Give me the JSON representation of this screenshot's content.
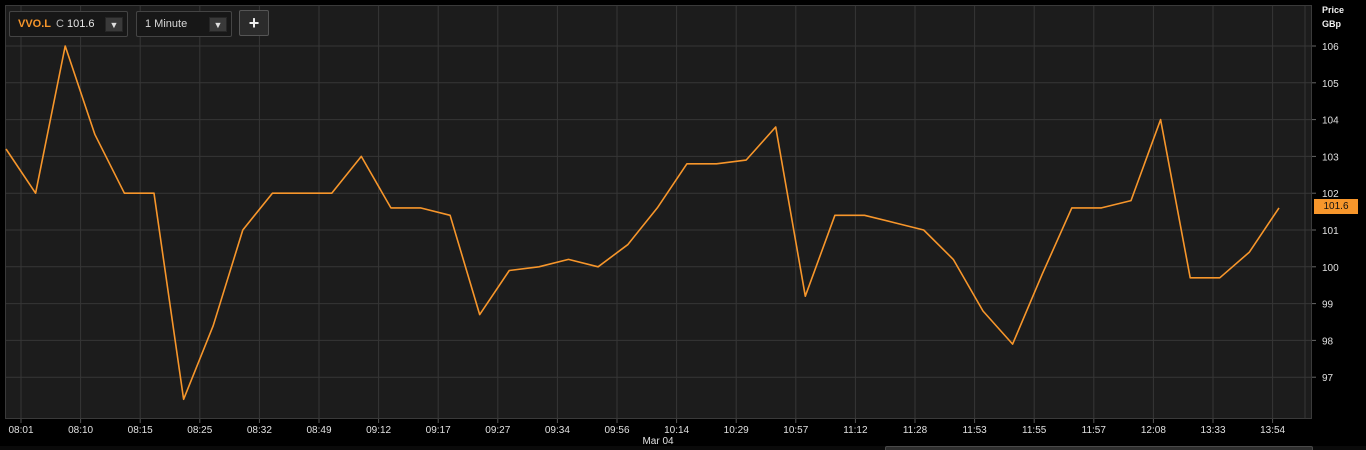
{
  "toolbar": {
    "symbol": "VVO.L",
    "close_label": "C",
    "close_value": "101.6",
    "interval": "1 Minute",
    "dropdown_glyph": "▼",
    "add_glyph": "+",
    "add_icon": "plus-icon"
  },
  "axis": {
    "price_label": "Price",
    "currency_label": "GBp",
    "last_price_badge": "101.6",
    "date_label": "Mar 04"
  },
  "colors": {
    "background": "#000000",
    "plot_background": "#1c1c1c",
    "grid": "#363636",
    "line": "#f7962b",
    "axis_text": "#e0e0e0"
  },
  "chart_data": {
    "type": "line",
    "series": [
      {
        "values": [
          103.2,
          102.0,
          106.0,
          103.6,
          102.0,
          102.0,
          96.4,
          98.4,
          101.0,
          102.0,
          102.0,
          102.0,
          103.0,
          101.6,
          101.6,
          101.4,
          98.7,
          99.9,
          100.0,
          100.2,
          100.0,
          100.6,
          101.6,
          102.8,
          102.8,
          102.9,
          103.8,
          99.2,
          101.4,
          101.4,
          101.2,
          101.0,
          100.2,
          98.8,
          97.9,
          99.8,
          101.6,
          101.6,
          101.8,
          104.0,
          99.7,
          99.7,
          100.4,
          101.6
        ]
      }
    ],
    "x_tick_labels": [
      "08:01",
      "08:10",
      "08:15",
      "08:25",
      "08:32",
      "08:49",
      "09:12",
      "09:17",
      "09:27",
      "09:34",
      "09:56",
      "10:14",
      "10:29",
      "10:57",
      "11:12",
      "11:28",
      "11:53",
      "11:55",
      "11:57",
      "12:08",
      "13:33",
      "13:54"
    ],
    "x_date_label": "Mar 04",
    "y_ticks": [
      97,
      98,
      99,
      100,
      101,
      102,
      103,
      104,
      105,
      106
    ],
    "ylim": [
      96.4,
      106.0
    ],
    "grid": true,
    "legend": "none"
  }
}
